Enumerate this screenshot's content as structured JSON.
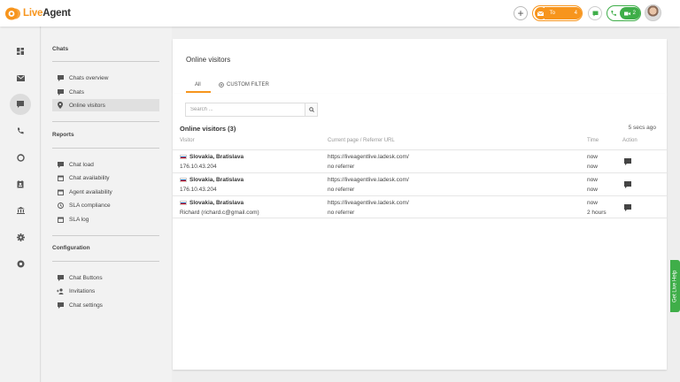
{
  "app": {
    "name_prefix": "Live",
    "name_suffix": "Agent",
    "brand_color": "#f7951d",
    "accent_green": "#3fae49"
  },
  "header": {
    "to_solve_label": "To solve",
    "to_solve_count": "4",
    "calls_count": "2"
  },
  "sidebar_icons": [
    "dashboard-icon",
    "mail-icon",
    "chat-icon",
    "phone-icon",
    "knowledge-icon",
    "contacts-icon",
    "reports-icon",
    "settings-icon",
    "help-icon"
  ],
  "nav": {
    "chats_section": "Chats",
    "chats_items": [
      {
        "label": "Chats overview",
        "icon": "chat-bubble-icon"
      },
      {
        "label": "Chats",
        "icon": "chat-bubble-icon"
      },
      {
        "label": "Online visitors",
        "icon": "map-pin-icon"
      }
    ],
    "reports_section": "Reports",
    "reports_items": [
      {
        "label": "Chat load",
        "icon": "chat-bubble-icon"
      },
      {
        "label": "Chat availability",
        "icon": "calendar-icon"
      },
      {
        "label": "Agent availability",
        "icon": "calendar-icon"
      },
      {
        "label": "SLA compliance",
        "icon": "clock-icon"
      },
      {
        "label": "SLA log",
        "icon": "calendar-icon"
      }
    ],
    "config_section": "Configuration",
    "config_items": [
      {
        "label": "Chat Buttons",
        "icon": "chat-bubble-icon"
      },
      {
        "label": "Invitations",
        "icon": "person-add-icon"
      },
      {
        "label": "Chat settings",
        "icon": "chat-bubble-icon"
      }
    ]
  },
  "main": {
    "title": "Online visitors",
    "tabs": {
      "all": "All",
      "custom_filter": "CUSTOM FILTER"
    },
    "search_placeholder": "Search ...",
    "list_title": "Online visitors (3)",
    "refresh_info": "5 secs ago",
    "columns": {
      "visitor": "Visitor",
      "page": "Current page / Referrer URL",
      "time": "Time",
      "action": "Action"
    },
    "rows": [
      {
        "location": "Slovakia, Bratislava",
        "identity": "176.10.43.204",
        "page": "https://liveagentlive.ladesk.com/",
        "referrer": "no referrer",
        "time1": "now",
        "time2": "now"
      },
      {
        "location": "Slovakia, Bratislava",
        "identity": "176.10.43.204",
        "page": "https://liveagentlive.ladesk.com/",
        "referrer": "no referrer",
        "time1": "now",
        "time2": "now"
      },
      {
        "location": "Slovakia, Bratislava",
        "identity": "Richard (richard.c@gmail.com)",
        "page": "https://liveagentlive.ladesk.com/",
        "referrer": "no referrer",
        "time1": "now",
        "time2": "2 hours"
      }
    ]
  },
  "live_help": "Get Live Help"
}
